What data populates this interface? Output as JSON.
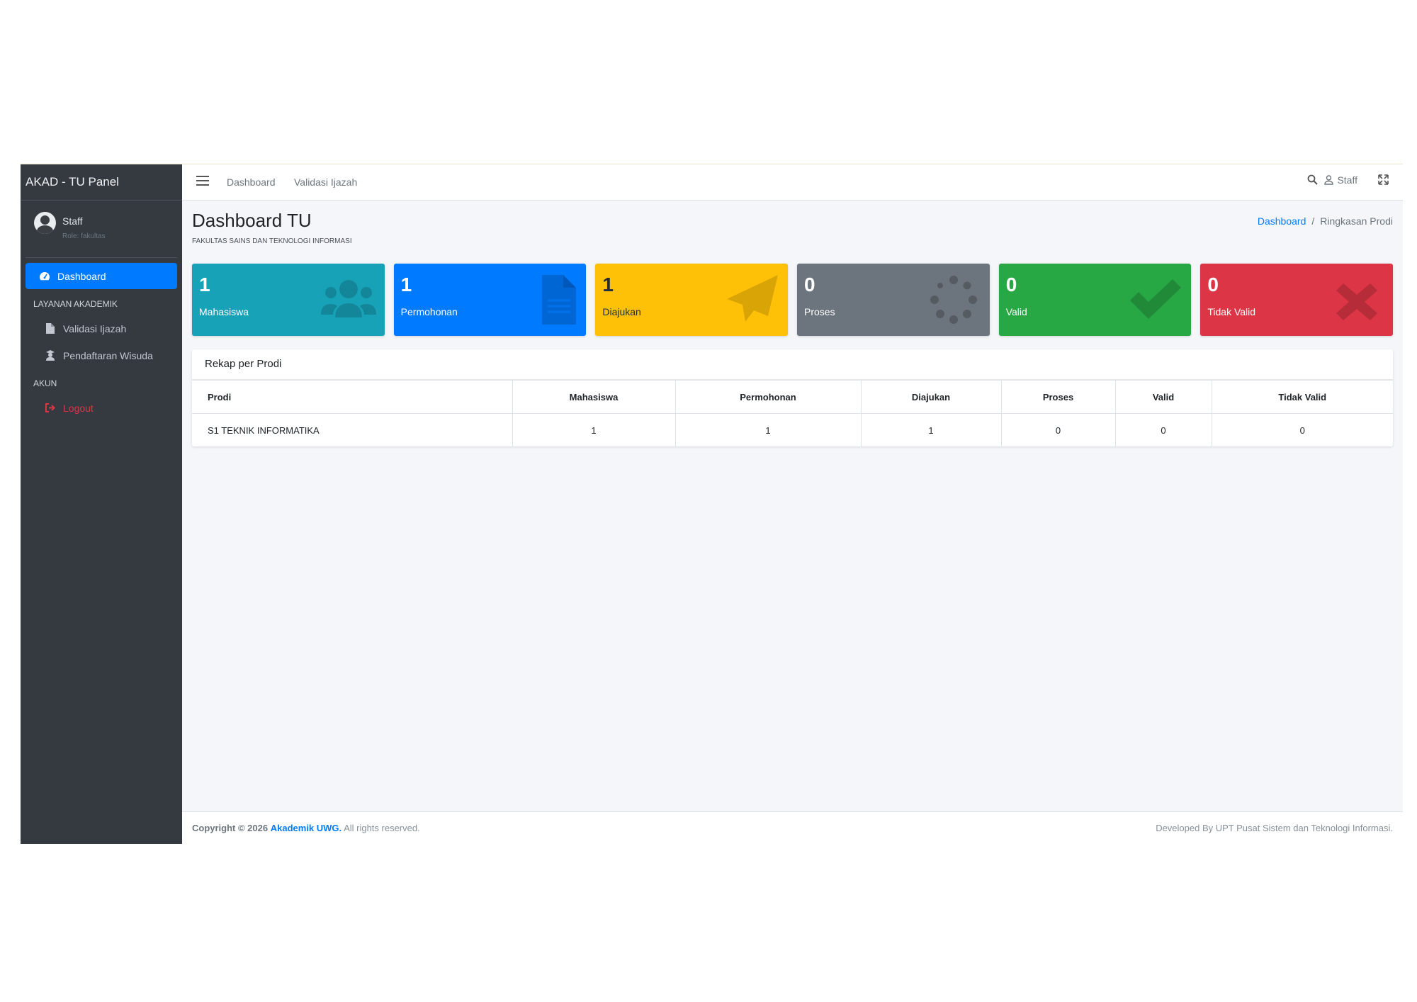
{
  "brand": "AKAD - TU Panel",
  "user": {
    "name": "Staff",
    "role": "Role: fakultas"
  },
  "sidebar": {
    "dashboard_label": "Dashboard",
    "section_akademik": "LAYANAN AKADEMIK",
    "items": [
      {
        "label": "Validasi Ijazah",
        "icon": "file-icon"
      },
      {
        "label": "Pendaftaran Wisuda",
        "icon": "graduate-icon"
      }
    ],
    "section_akun": "AKUN",
    "logout_label": "Logout"
  },
  "topbar": {
    "links": [
      "Dashboard",
      "Validasi Ijazah"
    ],
    "user_label": "Staff"
  },
  "page": {
    "title": "Dashboard TU",
    "subtitle": "FAKULTAS SAINS DAN TEKNOLOGI INFORMASI",
    "breadcrumb": {
      "home": "Dashboard",
      "current": "Ringkasan Prodi"
    }
  },
  "cards": [
    {
      "value": "1",
      "label": "Mahasiswa",
      "color": "#17a2b8",
      "icon": "users-icon"
    },
    {
      "value": "1",
      "label": "Permohonan",
      "color": "#007bff",
      "icon": "document-icon"
    },
    {
      "value": "1",
      "label": "Diajukan",
      "color": "#ffc107",
      "icon": "paper-plane-icon"
    },
    {
      "value": "0",
      "label": "Proses",
      "color": "#6c757d",
      "icon": "spinner-icon"
    },
    {
      "value": "0",
      "label": "Valid",
      "color": "#28a745",
      "icon": "check-icon"
    },
    {
      "value": "0",
      "label": "Tidak Valid",
      "color": "#dc3545",
      "icon": "times-icon"
    }
  ],
  "recap": {
    "title": "Rekap per Prodi",
    "columns": [
      "Prodi",
      "Mahasiswa",
      "Permohonan",
      "Diajukan",
      "Proses",
      "Valid",
      "Tidak Valid"
    ],
    "rows": [
      [
        "S1 TEKNIK INFORMATIKA",
        "1",
        "1",
        "1",
        "0",
        "0",
        "0"
      ]
    ]
  },
  "footer": {
    "copyright": "Copyright © 2026",
    "brand_link": "Akademik UWG.",
    "rights": "All rights reserved.",
    "developer": "Developed By UPT Pusat Sistem dan Teknologi Informasi."
  }
}
